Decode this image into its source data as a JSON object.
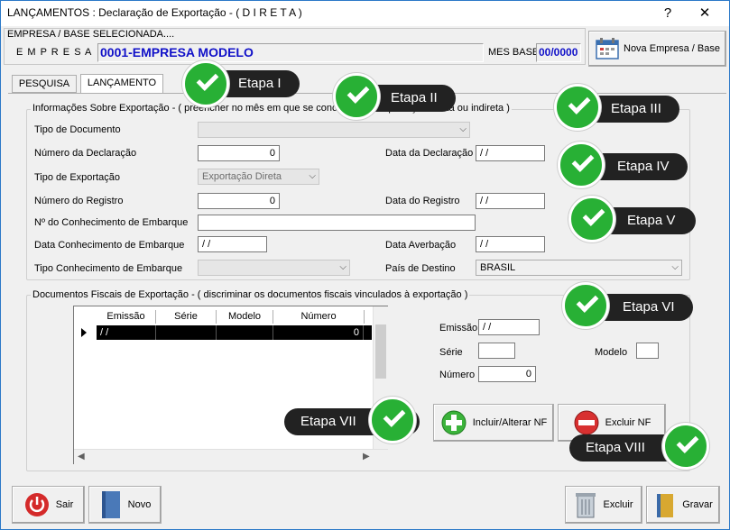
{
  "window": {
    "title": "LANÇAMENTOS : Declaração de Exportação - ( D I R E T A )",
    "help_glyph": "?",
    "close_glyph": "✕"
  },
  "empresa": {
    "header_label": "EMPRESA / BASE SELECIONADA....",
    "empresa_label": "E M P R E S A",
    "empresa_value": "0001-EMPRESA MODELO",
    "mes_base_label": "MES BASE",
    "mes_base_value": "00/0000",
    "nova_empresa_label": "Nova Empresa / Base"
  },
  "tabs": [
    {
      "label": "PESQUISA"
    },
    {
      "label": "LANÇAMENTO"
    }
  ],
  "info_group": {
    "title": "Informações Sobre Exportação - ( preencher no mês em que se concretizou a exportação direta ou indireta )",
    "tipo_documento_label": "Tipo de Documento",
    "tipo_documento_value": "",
    "numero_declaracao_label": "Número da Declaração",
    "numero_declaracao_value": "0",
    "data_declaracao_label": "Data da Declaração",
    "data_declaracao_value": "/ /",
    "tipo_exportacao_label": "Tipo de Exportação",
    "tipo_exportacao_value": "Exportação Direta",
    "numero_registro_label": "Número do Registro",
    "numero_registro_value": "0",
    "data_registro_label": "Data do Registro",
    "data_registro_value": "/ /",
    "conhecimento_label": "Nº do Conhecimento de Embarque",
    "conhecimento_value": "",
    "data_conhecimento_label": "Data Conhecimento de Embarque",
    "data_conhecimento_value": "/ /",
    "data_averbacao_label": "Data Averbação",
    "data_averbacao_value": "/ /",
    "tipo_conhecimento_label": "Tipo Conhecimento de Embarque",
    "tipo_conhecimento_value": "",
    "pais_destino_label": "País de Destino",
    "pais_destino_value": "BRASIL"
  },
  "docs_group": {
    "title": "Documentos Fiscais de Exportação - ( discriminar os documentos fiscais vinculados à exportação )",
    "columns": [
      "Emissão",
      "Série",
      "Modelo",
      "Número"
    ],
    "rows": [
      {
        "emissao": "/ /",
        "serie": "",
        "modelo": "",
        "numero": "0"
      }
    ],
    "emissao_label": "Emissão",
    "emissao_value": "/ /",
    "serie_label": "Série",
    "serie_value": "",
    "modelo_label": "Modelo",
    "modelo_value": "",
    "numero_label": "Número",
    "numero_value": "0",
    "incluir_label": "Incluir/Alterar NF",
    "excluir_nf_label": "Excluir NF"
  },
  "footer": {
    "sair_label": "Sair",
    "novo_label": "Novo",
    "excluir_label": "Excluir",
    "gravar_label": "Gravar"
  },
  "callouts": [
    {
      "label": "Etapa I"
    },
    {
      "label": "Etapa II"
    },
    {
      "label": "Etapa III"
    },
    {
      "label": "Etapa IV"
    },
    {
      "label": "Etapa V"
    },
    {
      "label": "Etapa VI"
    },
    {
      "label": "Etapa VII"
    },
    {
      "label": "Etapa VIII"
    }
  ],
  "colors": {
    "accent": "#28b035",
    "callout_bg": "#222222",
    "empresa_text": "#1010c8"
  }
}
